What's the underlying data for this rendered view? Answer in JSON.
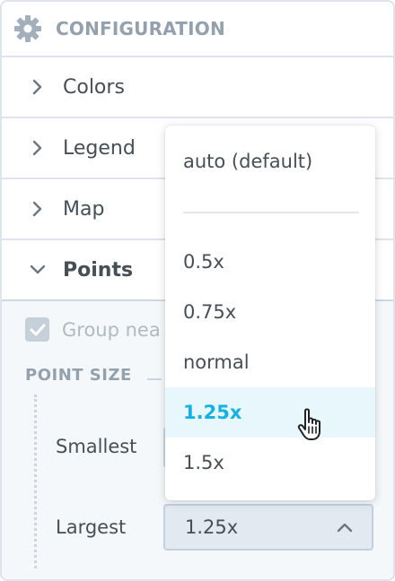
{
  "header": {
    "title": "CONFIGURATION",
    "icon": "gear-icon"
  },
  "sections": [
    {
      "label": "Colors",
      "expanded": false
    },
    {
      "label": "Legend",
      "expanded": false
    },
    {
      "label": "Map",
      "expanded": false
    },
    {
      "label": "Points",
      "expanded": true
    }
  ],
  "points": {
    "group_checkbox": {
      "label": "Group nea",
      "checked": true,
      "disabled": true
    },
    "point_size": {
      "title": "POINT SIZE",
      "smallest_label": "Smallest",
      "largest_label": "Largest",
      "largest_value": "1.25x"
    }
  },
  "dropdown": {
    "options": [
      "auto (default)",
      "0.5x",
      "0.75x",
      "normal",
      "1.25x",
      "1.5x"
    ],
    "selected": "1.25x"
  },
  "colors": {
    "accent": "#14b2e2",
    "selected_bg": "#e8f7fc",
    "text": "#464e56",
    "muted": "#94a1ad",
    "border": "#dde4eb"
  }
}
